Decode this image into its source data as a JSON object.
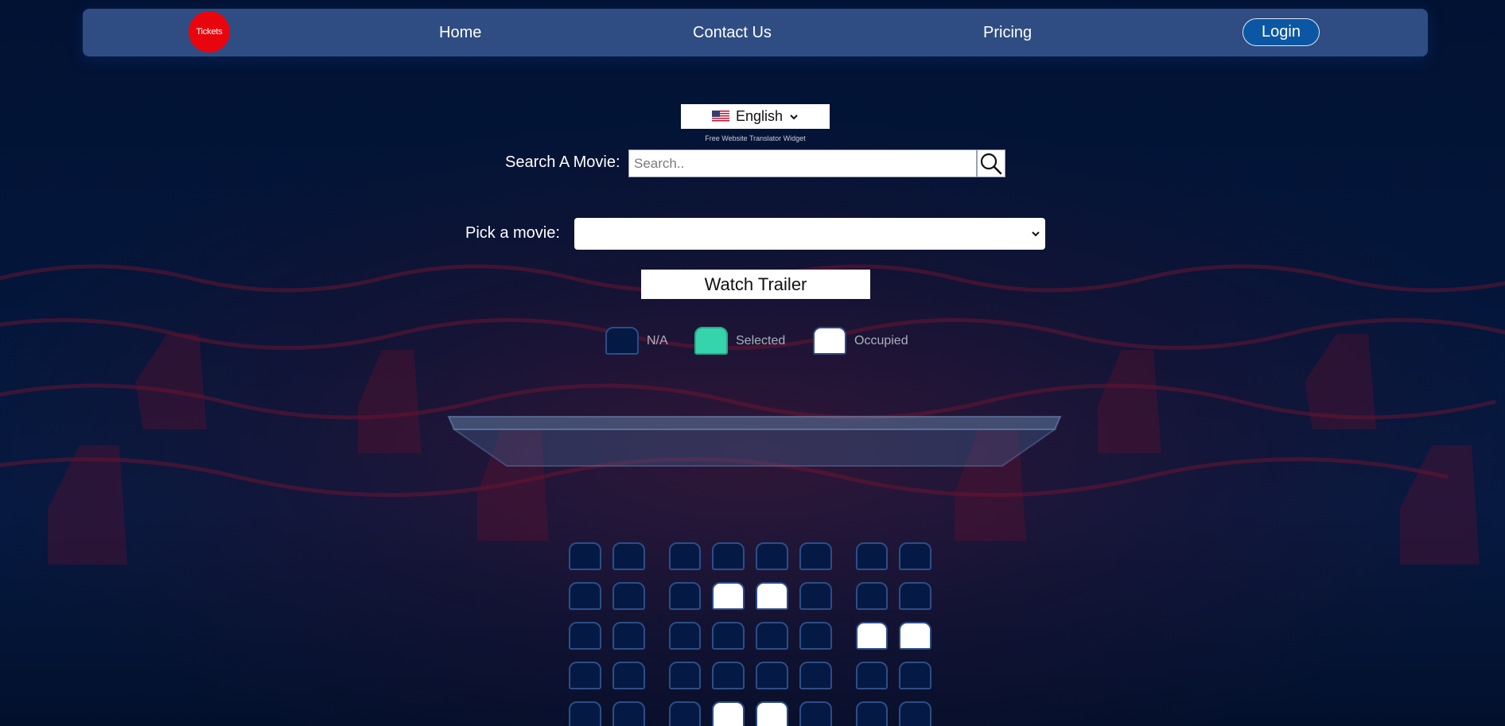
{
  "nav": {
    "logo_text": "Tickets",
    "links": [
      {
        "label": "Home"
      },
      {
        "label": "Contact Us"
      },
      {
        "label": "Pricing"
      }
    ],
    "login_label": "Login",
    "colors": {
      "bar": "#2f4d82",
      "logo": "#e8050d",
      "login": "#0b57a3"
    }
  },
  "translator": {
    "language": "English",
    "flag_icon": "us-flag-icon",
    "caption": "Free Website Translator Widget"
  },
  "search": {
    "label": "Search A Movie:",
    "placeholder": "Search..",
    "value": "",
    "icon": "search-icon"
  },
  "movie_picker": {
    "label": "Pick a movie:",
    "selected": ""
  },
  "trailer_button": "Watch Trailer",
  "legend": [
    {
      "status": "na",
      "label": "N/A",
      "color": "#041a45"
    },
    {
      "status": "selected",
      "label": "Selected",
      "color": "#35d4ac"
    },
    {
      "status": "occupied",
      "label": "Occupied",
      "color": "#ffffff"
    }
  ],
  "seating": {
    "column_groups": [
      2,
      4,
      2
    ],
    "rows": [
      [
        "na",
        "na",
        "na",
        "na",
        "na",
        "na",
        "na",
        "na"
      ],
      [
        "na",
        "na",
        "na",
        "occupied",
        "occupied",
        "na",
        "na",
        "na"
      ],
      [
        "na",
        "na",
        "na",
        "na",
        "na",
        "na",
        "occupied",
        "occupied"
      ],
      [
        "na",
        "na",
        "na",
        "na",
        "na",
        "na",
        "na",
        "na"
      ],
      [
        "na",
        "na",
        "na",
        "occupied",
        "occupied",
        "na",
        "na",
        "na"
      ]
    ]
  }
}
